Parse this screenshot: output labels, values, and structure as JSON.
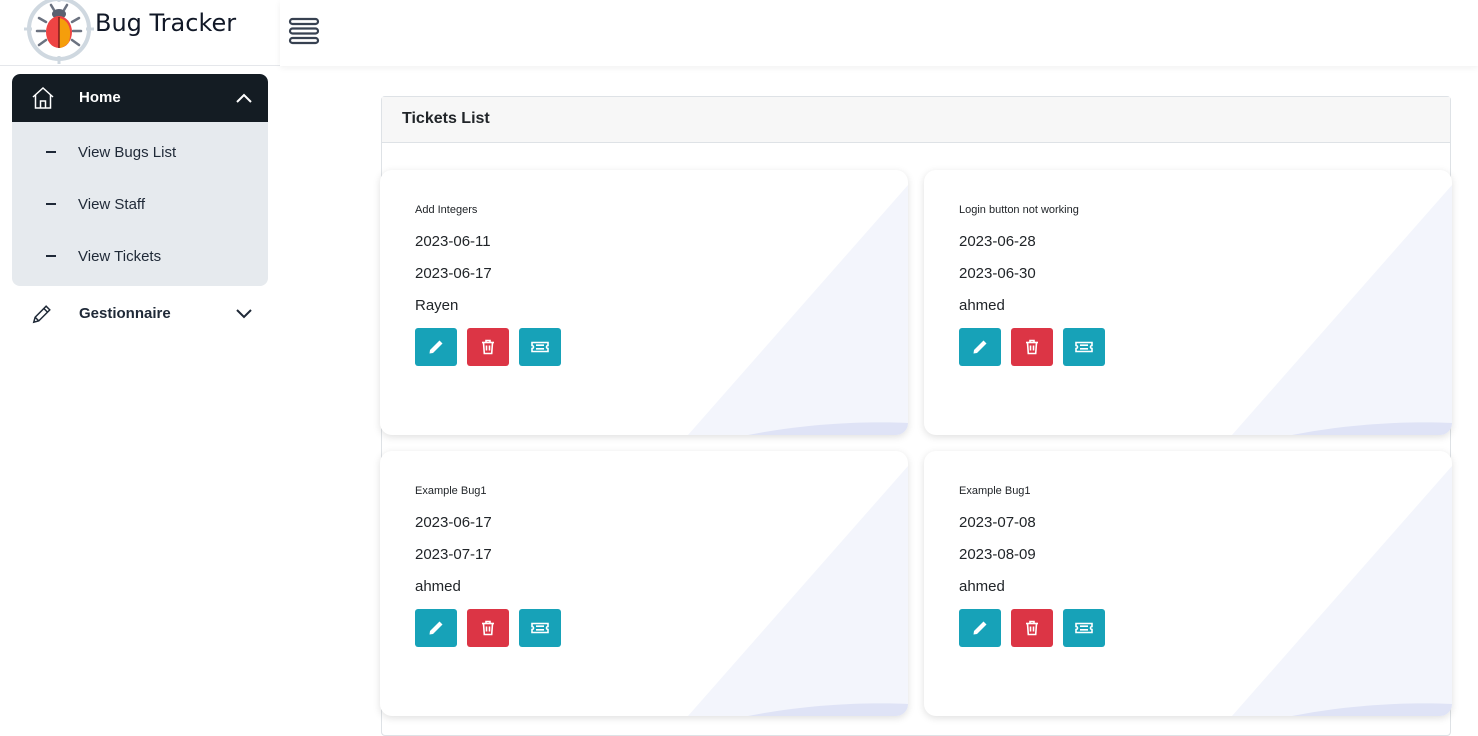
{
  "app": {
    "title": "Bug Tracker"
  },
  "sidebar": {
    "home": {
      "label": "Home"
    },
    "items": [
      {
        "label": "View Bugs List"
      },
      {
        "label": "View Staff"
      },
      {
        "label": "View Tickets"
      }
    ],
    "gestionnaire": {
      "label": "Gestionnaire"
    }
  },
  "panel": {
    "title": "Tickets List"
  },
  "tickets": [
    {
      "title": "Add Integers",
      "start_date": "2023-06-11",
      "end_date": "2023-06-17",
      "user": "Rayen"
    },
    {
      "title": "Login button not working",
      "start_date": "2023-06-28",
      "end_date": "2023-06-30",
      "user": "ahmed"
    },
    {
      "title": "Example Bug1",
      "start_date": "2023-06-17",
      "end_date": "2023-07-17",
      "user": "ahmed"
    },
    {
      "title": "Example Bug1",
      "start_date": "2023-07-08",
      "end_date": "2023-08-09",
      "user": "ahmed"
    }
  ],
  "colors": {
    "accent": "#17a2b8",
    "danger": "#dc3545",
    "sidebar_active": "#141c23",
    "sidebar_sub_bg": "#e6eaee"
  },
  "icons": {
    "home": "home-icon",
    "gestionnaire": "pencil-icon",
    "edit": "pencil-icon",
    "delete": "trash-icon",
    "ticket": "ticket-icon",
    "menu": "hamburger-icon"
  }
}
